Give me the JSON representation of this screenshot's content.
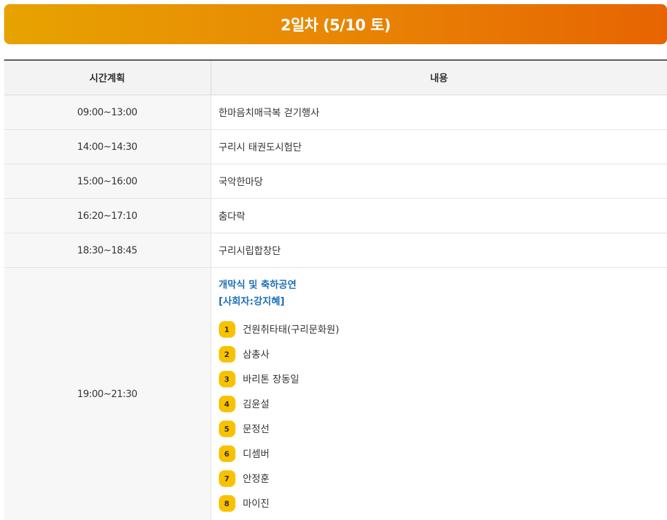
{
  "header": {
    "title": "2일차 (5/10 토)"
  },
  "table": {
    "columns": {
      "time": "시간계획",
      "content": "내용"
    },
    "rows": [
      {
        "time": "09:00~13:00",
        "content": "한마음치매극복 걷기행사"
      },
      {
        "time": "14:00~14:30",
        "content": "구리시 태권도시험단"
      },
      {
        "time": "15:00~16:00",
        "content": "국악한마당"
      },
      {
        "time": "16:20~17:10",
        "content": "춤다락"
      },
      {
        "time": "18:30~18:45",
        "content": "구리시립합창단"
      }
    ],
    "main_event": {
      "time": "19:00~21:30",
      "title": "개막식 및 축하공연",
      "host": "[사회자:강지혜]",
      "performers": [
        {
          "num": "1",
          "name": "건원취타태(구리문화원)"
        },
        {
          "num": "2",
          "name": "삼총사"
        },
        {
          "num": "3",
          "name": "바리톤 장동일"
        },
        {
          "num": "4",
          "name": "김윤설"
        },
        {
          "num": "5",
          "name": "문정선"
        },
        {
          "num": "6",
          "name": "디셈버"
        },
        {
          "num": "7",
          "name": "안정훈"
        },
        {
          "num": "8",
          "name": "마이진"
        }
      ]
    }
  },
  "colors": {
    "header_gradient_start": "#e7a300",
    "header_gradient_end": "#e76402",
    "highlight_text": "#1e6fb8",
    "badge": "#f9c200"
  }
}
